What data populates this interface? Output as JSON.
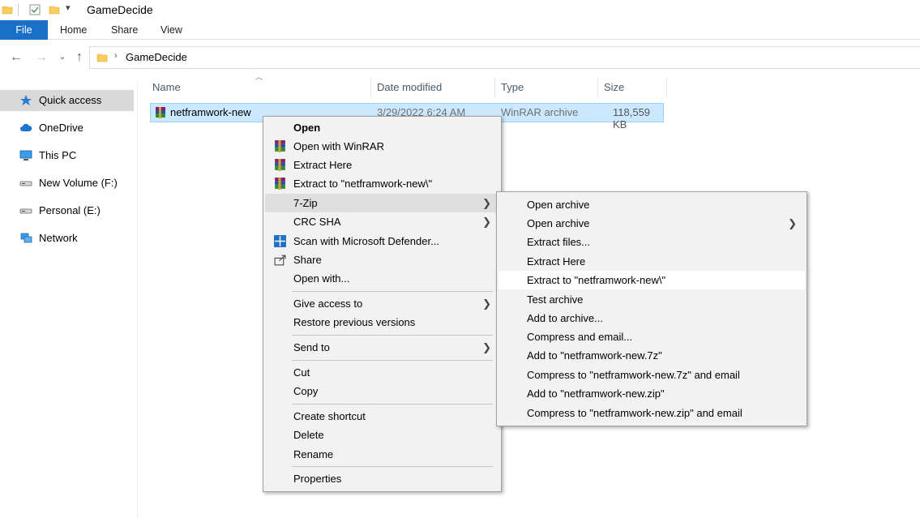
{
  "window": {
    "title": "GameDecide"
  },
  "ribbon": {
    "tabs": [
      "File",
      "Home",
      "Share",
      "View"
    ]
  },
  "address": {
    "path": "GameDecide"
  },
  "sidebar": {
    "items": [
      {
        "label": "Quick access",
        "icon": "star-icon"
      },
      {
        "label": "OneDrive",
        "icon": "cloud-icon"
      },
      {
        "label": "This PC",
        "icon": "computer-icon"
      },
      {
        "label": "New Volume (F:)",
        "icon": "drive-icon"
      },
      {
        "label": "Personal (E:)",
        "icon": "drive-icon"
      },
      {
        "label": "Network",
        "icon": "network-icon"
      }
    ]
  },
  "columns": {
    "name": "Name",
    "date": "Date modified",
    "type": "Type",
    "size": "Size"
  },
  "file": {
    "name": "netframwork-new",
    "date": "3/29/2022 6:24 AM",
    "type": "WinRAR archive",
    "size": "118,559 KB"
  },
  "context_menu": {
    "items": {
      "open": "Open",
      "open_winrar": "Open with WinRAR",
      "extract_here": "Extract Here",
      "extract_to": "Extract to \"netframwork-new\\\"",
      "seven_zip": "7-Zip",
      "crc_sha": "CRC SHA",
      "scan": "Scan with Microsoft Defender...",
      "share": "Share",
      "open_with": "Open with...",
      "give_access": "Give access to",
      "restore": "Restore previous versions",
      "send_to": "Send to",
      "cut": "Cut",
      "copy": "Copy",
      "create_shortcut": "Create shortcut",
      "delete": "Delete",
      "rename": "Rename",
      "properties": "Properties"
    }
  },
  "submenu_7zip": {
    "items": [
      "Open archive",
      "Open archive",
      "Extract files...",
      "Extract Here",
      "Extract to \"netframwork-new\\\"",
      "Test archive",
      "Add to archive...",
      "Compress and email...",
      "Add to \"netframwork-new.7z\"",
      "Compress to \"netframwork-new.7z\" and email",
      "Add to \"netframwork-new.zip\"",
      "Compress to \"netframwork-new.zip\" and email"
    ]
  },
  "colors": {
    "accent": "#1a6fc6",
    "selection": "#cce8ff",
    "menu_bg": "#f2f2f2"
  }
}
